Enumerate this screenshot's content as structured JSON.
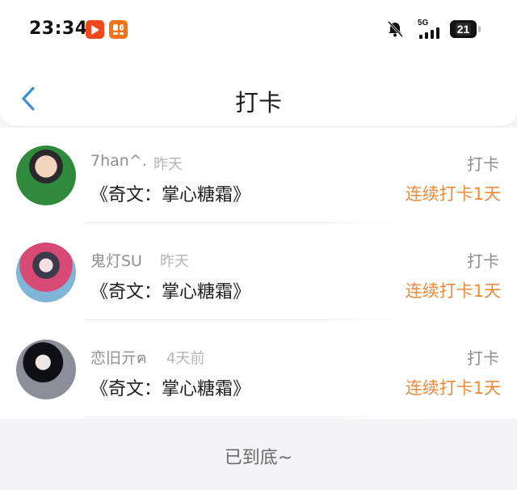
{
  "status_bar": {
    "time": "23:34",
    "network": "5G",
    "battery": "21"
  },
  "header": {
    "title": "打卡"
  },
  "checkins": [
    {
      "user": "7han^.",
      "when": "昨天",
      "book": "《奇文：掌心糖霜》",
      "action": "打卡",
      "streak": "连续打卡1天"
    },
    {
      "user": "鬼灯SU",
      "when": "昨天",
      "book": "《奇文：掌心糖霜》",
      "action": "打卡",
      "streak": "连续打卡1天"
    },
    {
      "user": "恋旧亓ฅ",
      "when": "4天前",
      "book": "《奇文：掌心糖霜》",
      "action": "打卡",
      "streak": "连续打卡1天"
    }
  ],
  "footer": {
    "end_text": "已到底~"
  },
  "colors": {
    "accent_back": "#3a8fd9",
    "streak": "#ee8a3c",
    "background": "#f4f4f6"
  },
  "icons": [
    "video-app-icon",
    "game-app-icon",
    "bell-muted-icon",
    "signal-icon",
    "battery-icon",
    "back-chevron-icon"
  ]
}
